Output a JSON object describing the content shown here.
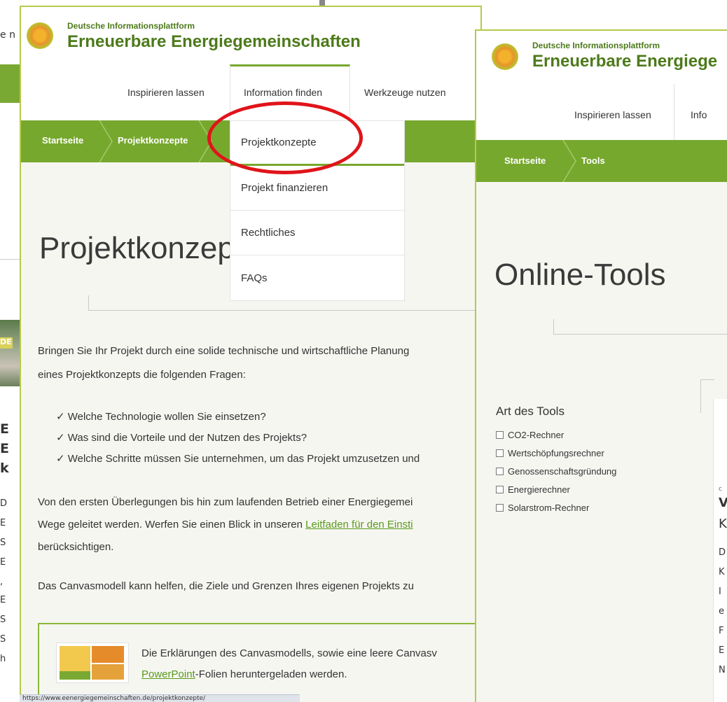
{
  "back_window": {
    "snippets": [
      "e n",
      "DE",
      "E",
      "E",
      "k",
      "D",
      "E",
      "S",
      "E",
      ",",
      "E",
      "S",
      "S",
      "h"
    ]
  },
  "window1": {
    "brand_small": "Deutsche Informationsplattform",
    "brand_big": "Erneuerbare Energiegemeinschaften",
    "nav": [
      "Inspirieren lassen",
      "Information finden",
      "Werkzeuge nutzen"
    ],
    "breadcrumb": [
      "Startseite",
      "Projektkonzepte"
    ],
    "dropdown": [
      "Projektkonzepte",
      "Projekt finanzieren",
      "Rechtliches",
      "FAQs"
    ],
    "page_title": "Projektkonzepte",
    "intro_line1": "Bringen Sie Ihr Projekt durch eine solide technische und wirtschaftliche Planung",
    "intro_line2": "eines Projektkonzepts die folgenden Fragen:",
    "questions": [
      "Welche Technologie wollen Sie einsetzen?",
      "Was sind die Vorteile und der Nutzen des Projekts?",
      "Welche Schritte müssen Sie unternehmen, um das Projekt umzusetzen und"
    ],
    "check_glyph": "✓",
    "para2_line1": "Von den ersten Überlegungen bis hin zum laufenden Betrieb einer Energiegemei",
    "para2_line2_pre": "Wege geleitet werden. Werfen Sie einen Blick in unseren ",
    "para2_line2_link": "Leitfaden für den Einsti",
    "para2_line3": "berücksichtigen.",
    "para3": "Das Canvasmodell kann helfen, die Ziele und Grenzen Ihres eigenen Projekts zu",
    "infobox_line1": "Die Erklärungen des Canvasmodells, sowie eine leere Canvasv",
    "infobox_link": "PowerPoint",
    "infobox_line2_post": "-Folien heruntergeladen werden.",
    "status_url": "https://www.eenergiegemeinschaften.de/projektkonzepte/"
  },
  "window2": {
    "brand_small": "Deutsche Informationsplattform",
    "brand_big": "Erneuerbare Energiege",
    "nav": [
      "Inspirieren lassen",
      "Info"
    ],
    "breadcrumb": [
      "Startseite",
      "Tools"
    ],
    "page_title": "Online-Tools",
    "filter_heading": "Art des Tools",
    "filters": [
      "CO2-Rechner",
      "Wertschöpfungsrechner",
      "Genossenschaftsgründung",
      "Energierechner",
      "Solarstrom-Rechner"
    ],
    "card_snippets": [
      "c",
      "V",
      "K",
      "D",
      "K",
      "I",
      "e",
      "F",
      "E",
      "N"
    ]
  },
  "colors": {
    "green": "#77a82e",
    "brand_text": "#4d7a1a",
    "window_border": "#b7c94a",
    "annotation": "#e0141a",
    "link": "#5a9a1d"
  }
}
